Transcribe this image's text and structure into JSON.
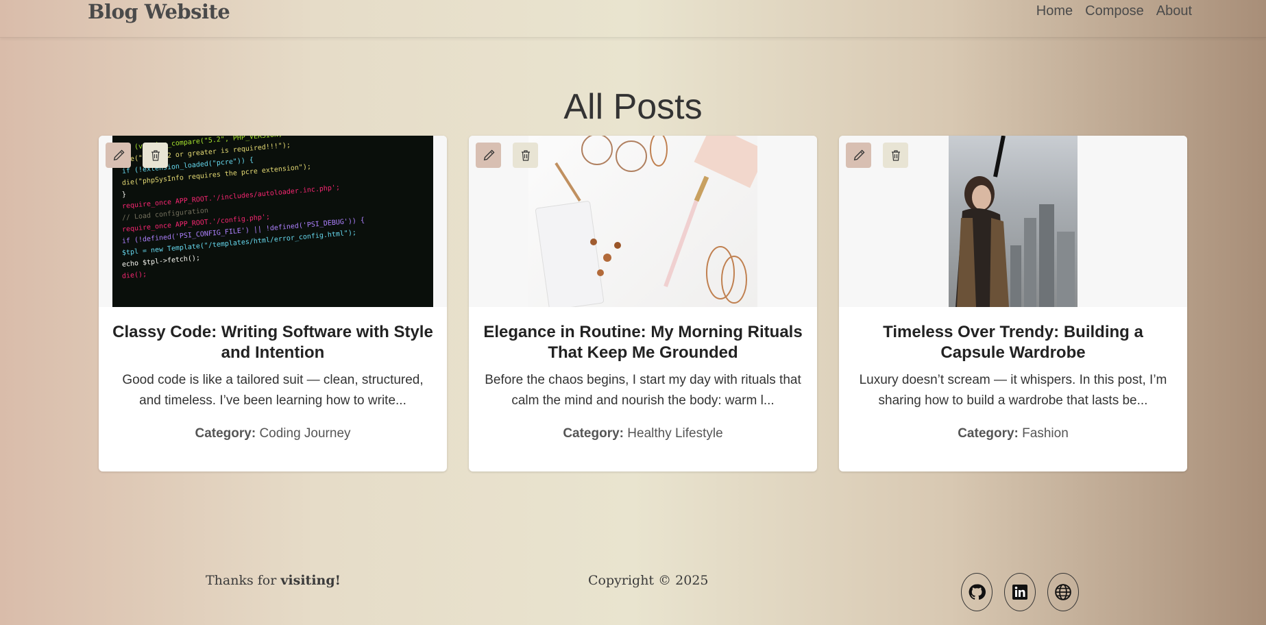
{
  "navbar": {
    "brand": "Blog Website",
    "links": [
      "Home",
      "Compose",
      "About"
    ]
  },
  "page_title": "All Posts",
  "posts": [
    {
      "title": "Classy Code: Writing Software with Style and Intention",
      "excerpt": "Good code is like a tailored suit — clean, structured, and timeless. I’ve been learning how to write...",
      "category_label": "Category:",
      "category": "Coding Journey",
      "image": "code-screenshot"
    },
    {
      "title": "Elegance in Routine: My Morning Rituals That Keep Me Grounded",
      "excerpt": "Before the chaos begins, I start my day with rituals that calm the mind and nourish the body: warm l...",
      "category_label": "Category:",
      "category": "Healthy Lifestyle",
      "image": "desk-flatlay"
    },
    {
      "title": "Timeless Over Trendy: Building a Capsule Wardrobe",
      "excerpt": "Luxury doesn’t scream — it whispers. In this post, I’m sharing how to build a wardrobe that lasts be...",
      "category_label": "Category:",
      "category": "Fashion",
      "image": "city-portrait"
    }
  ],
  "footer": {
    "thanks_prefix": "Thanks for ",
    "thanks_bold": "visiting!",
    "copyright": "Copyright © 2025",
    "social_icons": [
      "github-icon",
      "linkedin-icon",
      "globe-icon"
    ]
  }
}
